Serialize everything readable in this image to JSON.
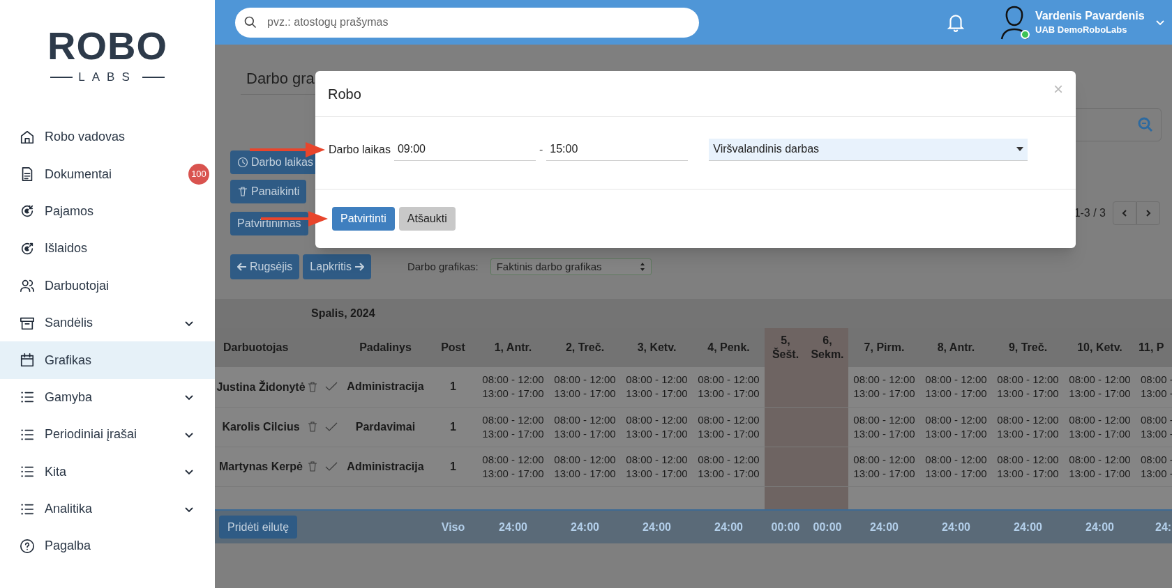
{
  "sidebar": {
    "logo": {
      "word": "ROBO",
      "subword": "LABS"
    },
    "items": [
      {
        "label": "Robo vadovas",
        "kind": "home",
        "selected": false,
        "expandable": false
      },
      {
        "label": "Dokumentai",
        "kind": "document",
        "selected": false,
        "expandable": false,
        "badge": "100"
      },
      {
        "label": "Pajamos",
        "kind": "income",
        "selected": false,
        "expandable": false
      },
      {
        "label": "Išlaidos",
        "kind": "expense",
        "selected": false,
        "expandable": false
      },
      {
        "label": "Darbuotojai",
        "kind": "people",
        "selected": false,
        "expandable": false
      },
      {
        "label": "Sandėlis",
        "kind": "archive",
        "selected": false,
        "expandable": true
      },
      {
        "label": "Grafikas",
        "kind": "calendar",
        "selected": true,
        "expandable": false
      },
      {
        "label": "Gamyba",
        "kind": "list",
        "selected": false,
        "expandable": true
      },
      {
        "label": "Periodiniai įrašai",
        "kind": "list",
        "selected": false,
        "expandable": true
      },
      {
        "label": "Kita",
        "kind": "list",
        "selected": false,
        "expandable": true
      },
      {
        "label": "Analitika",
        "kind": "list",
        "selected": false,
        "expandable": true
      },
      {
        "label": "Pagalba",
        "kind": "help",
        "selected": false,
        "expandable": false
      }
    ]
  },
  "top_bar": {
    "search": {
      "placeholder": "pvz.: atostogų prašymas"
    },
    "user": {
      "name": "Vardenis Pavardenis",
      "company": "UAB DemoRoboLabs",
      "online": true
    }
  },
  "page": {
    "title": "Darbo gra",
    "actions": [
      {
        "label": "Darbo laikas",
        "kind": "clock"
      },
      {
        "label": "Panaikinti",
        "kind": "trash"
      },
      {
        "label": "Patvirtinimas"
      }
    ],
    "pagination": "1-3 / 3",
    "month_nav": {
      "previous": "Rugsėjis",
      "next": "Lapkritis"
    },
    "schedule": {
      "label": "Darbo grafikas:",
      "value": "Faktinis darbo grafikas"
    }
  },
  "table": {
    "month": "Spalis, 2024",
    "columns": [
      "Darbuotojas",
      "Padalinys",
      "Post"
    ],
    "days": [
      {
        "label": "1, Antr.",
        "weekend": false
      },
      {
        "label": "2, Treč.",
        "weekend": false
      },
      {
        "label": "3, Ketv.",
        "weekend": false
      },
      {
        "label": "4, Penk.",
        "weekend": false
      },
      {
        "label": "5, Šešt.",
        "weekend": true
      },
      {
        "label": "6, Sekm.",
        "weekend": true
      },
      {
        "label": "7, Pirm.",
        "weekend": false
      },
      {
        "label": "8, Antr.",
        "weekend": false
      },
      {
        "label": "9, Treč.",
        "weekend": false
      },
      {
        "label": "10, Ketv.",
        "weekend": false
      },
      {
        "label": "11, P",
        "weekend": false
      }
    ],
    "rows": [
      {
        "name": "Justina Židonytė",
        "department": "Administracija",
        "post": "1",
        "shifts": [
          [
            "08:00 - 12:00",
            "13:00 - 17:00"
          ],
          [
            "08:00 - 12:00",
            "13:00 - 17:00"
          ],
          [
            "08:00 - 12:00",
            "13:00 - 17:00"
          ],
          [
            "08:00 - 12:00",
            "13:00 - 17:00"
          ],
          [
            "08:00 - 12:00",
            "13:00 - 17:00"
          ],
          [
            "08:00 - 12:00",
            "13:00 - 17:00"
          ],
          [
            "08:00 - 12:00",
            "13:00 - 17:00"
          ],
          [
            "08:00 - 12:00",
            "13:00 - 17:00"
          ],
          [
            "08:00 -",
            "13:00 -"
          ]
        ]
      },
      {
        "name": "Karolis Cilcius",
        "department": "Pardavimai",
        "post": "1",
        "shifts": [
          [
            "08:00 - 12:00",
            "13:00 - 17:00"
          ],
          [
            "08:00 - 12:00",
            "13:00 - 17:00"
          ],
          [
            "08:00 - 12:00",
            "13:00 - 17:00"
          ],
          [
            "08:00 - 12:00",
            "13:00 - 17:00"
          ],
          [
            "08:00 - 12:00",
            "13:00 - 17:00"
          ],
          [
            "08:00 - 12:00",
            "13:00 - 17:00"
          ],
          [
            "08:00 - 12:00",
            "13:00 - 17:00"
          ],
          [
            "08:00 - 12:00",
            "13:00 - 17:00"
          ],
          [
            "08:00 -",
            "13:00 -"
          ]
        ]
      },
      {
        "name": "Martynas Kerpė",
        "department": "Administracija",
        "post": "1",
        "shifts": [
          [
            "08:00 - 12:00",
            "13:00 - 17:00"
          ],
          [
            "08:00 - 12:00",
            "13:00 - 17:00"
          ],
          [
            "08:00 - 12:00",
            "13:00 - 17:00"
          ],
          [
            "08:00 - 12:00",
            "13:00 - 17:00"
          ],
          [
            "08:00 - 12:00",
            "13:00 - 17:00"
          ],
          [
            "08:00 - 12:00",
            "13:00 - 17:00"
          ],
          [
            "08:00 - 12:00",
            "13:00 - 17:00"
          ],
          [
            "08:00 - 12:00",
            "13:00 - 17:00"
          ],
          [
            "08:00 -",
            "13:00 -"
          ]
        ]
      }
    ],
    "footer": {
      "add_row": "Pridėti eilutę",
      "total_label": "Viso",
      "totals": [
        "24:00",
        "24:00",
        "24:00",
        "24:00",
        "00:00",
        "00:00",
        "24:00",
        "24:00",
        "24:00",
        "24:00",
        "24:"
      ]
    }
  },
  "modal": {
    "title": "Robo",
    "close": "×",
    "label": "Darbo laikas",
    "from": "09:00",
    "separator": "-",
    "to": "15:00",
    "type": "Viršvalandinis darbas",
    "buttons": [
      {
        "label": "Patvirtinti",
        "kind": "primary"
      },
      {
        "label": "Atšaukti",
        "kind": "secondary"
      }
    ]
  }
}
